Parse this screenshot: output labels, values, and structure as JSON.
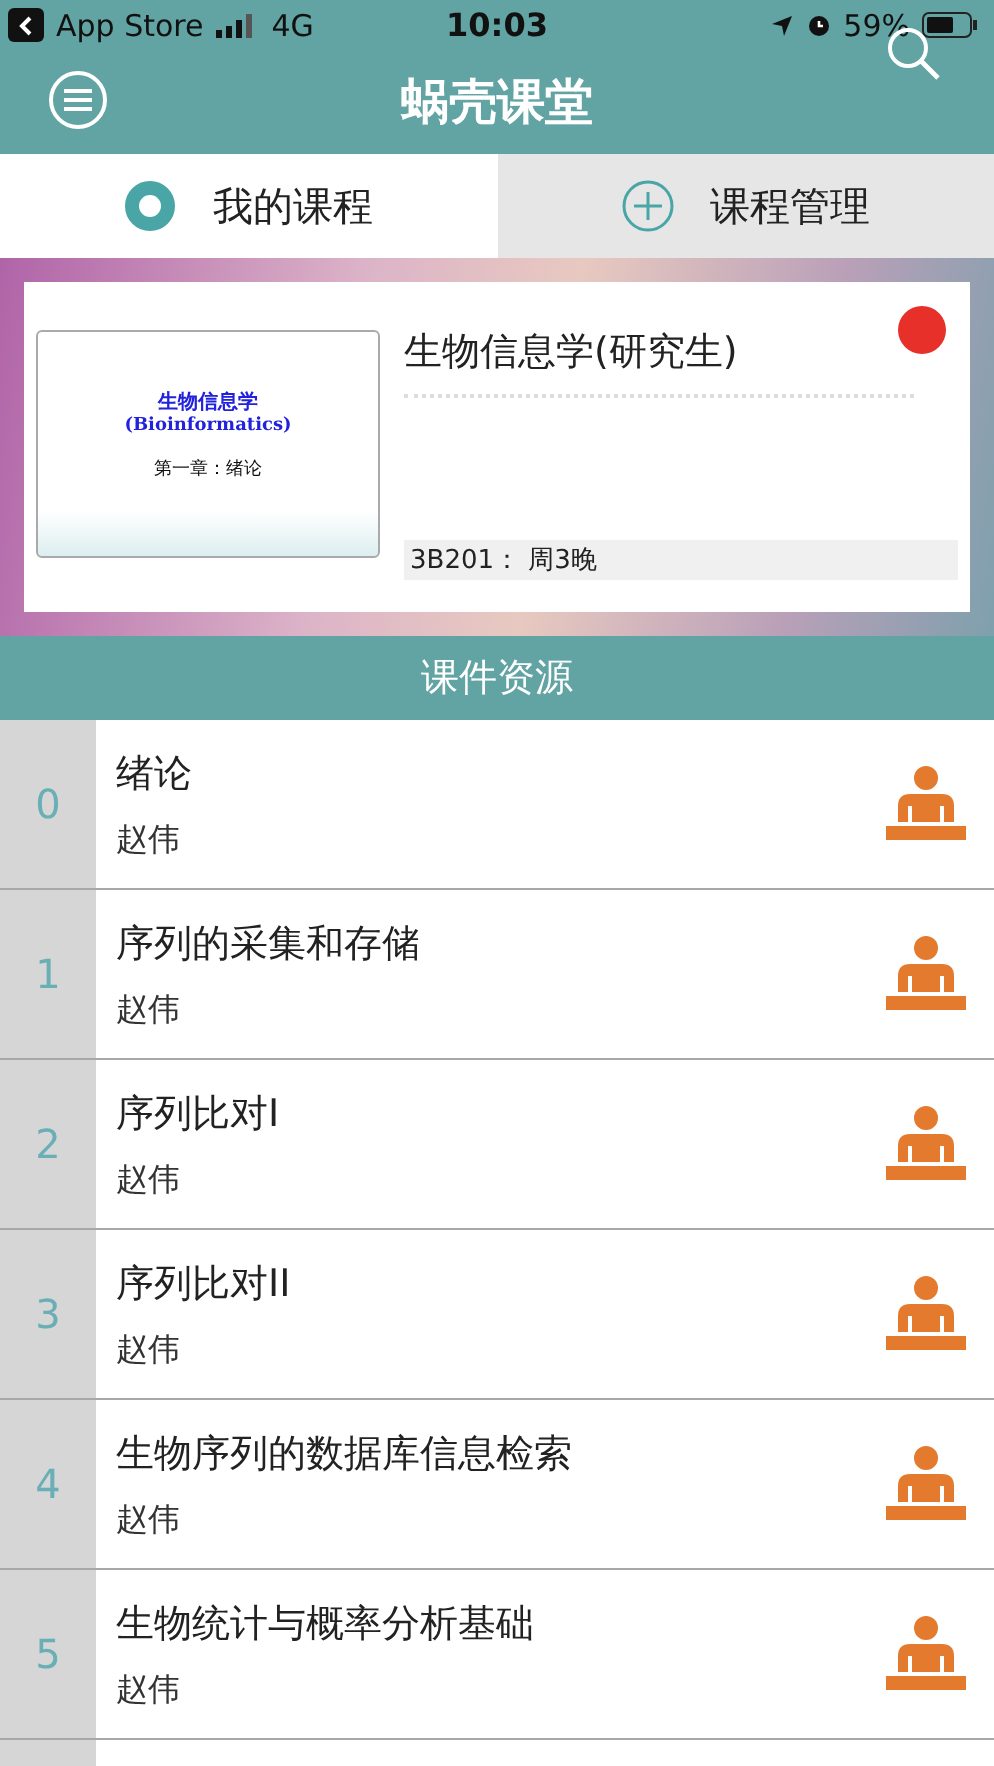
{
  "status_bar": {
    "back_app": "App Store",
    "network": "4G",
    "time": "10:03",
    "battery": "59%"
  },
  "header": {
    "title": "蜗壳课堂"
  },
  "tabs": [
    {
      "label": "我的课程",
      "kind": "view",
      "selected": true
    },
    {
      "label": "课程管理",
      "kind": "manage",
      "selected": false
    }
  ],
  "course": {
    "title": "生物信息学(研究生)",
    "color": "#e8302a",
    "schedule": "3B201： 周3晚",
    "slide": {
      "title": "生物信息学",
      "subtitle": "(Bioinformatics)",
      "chapter": "第一章：绪论"
    }
  },
  "section_title": "课件资源",
  "lessons": [
    {
      "number": "0",
      "title": "绪论",
      "teacher": "赵伟"
    },
    {
      "number": "1",
      "title": "序列的采集和存储",
      "teacher": "赵伟"
    },
    {
      "number": "2",
      "title": "序列比对I",
      "teacher": "赵伟"
    },
    {
      "number": "3",
      "title": "序列比对II",
      "teacher": "赵伟"
    },
    {
      "number": "4",
      "title": "生物序列的数据库信息检索",
      "teacher": "赵伟"
    },
    {
      "number": "5",
      "title": "生物统计与概率分析基础",
      "teacher": "赵伟"
    }
  ]
}
